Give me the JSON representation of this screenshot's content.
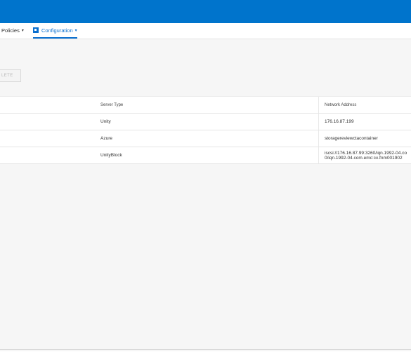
{
  "nav": {
    "policies_label": "Policies",
    "configuration_label": "Configuration",
    "caret": "▾"
  },
  "toolbar": {
    "delete_label": "LETE"
  },
  "table": {
    "columns": [
      "Server Type",
      "Network Address"
    ],
    "rows": [
      {
        "server_type": "Unity",
        "network_address": [
          "176.16.87.199"
        ]
      },
      {
        "server_type": "Azure",
        "network_address": [
          "storagereviewctacontainer"
        ]
      },
      {
        "server_type": "UnityBlock",
        "network_address": [
          "iscsi://176.16.87.99:3260/iqn.1992-04.co",
          "0/iqn.1992-04.com.emc:cx.fnm001902"
        ]
      }
    ]
  },
  "colors": {
    "header_blue": "#0074cc",
    "active_tab": "#0a6fcf",
    "content_bg": "#f6f6f6"
  }
}
